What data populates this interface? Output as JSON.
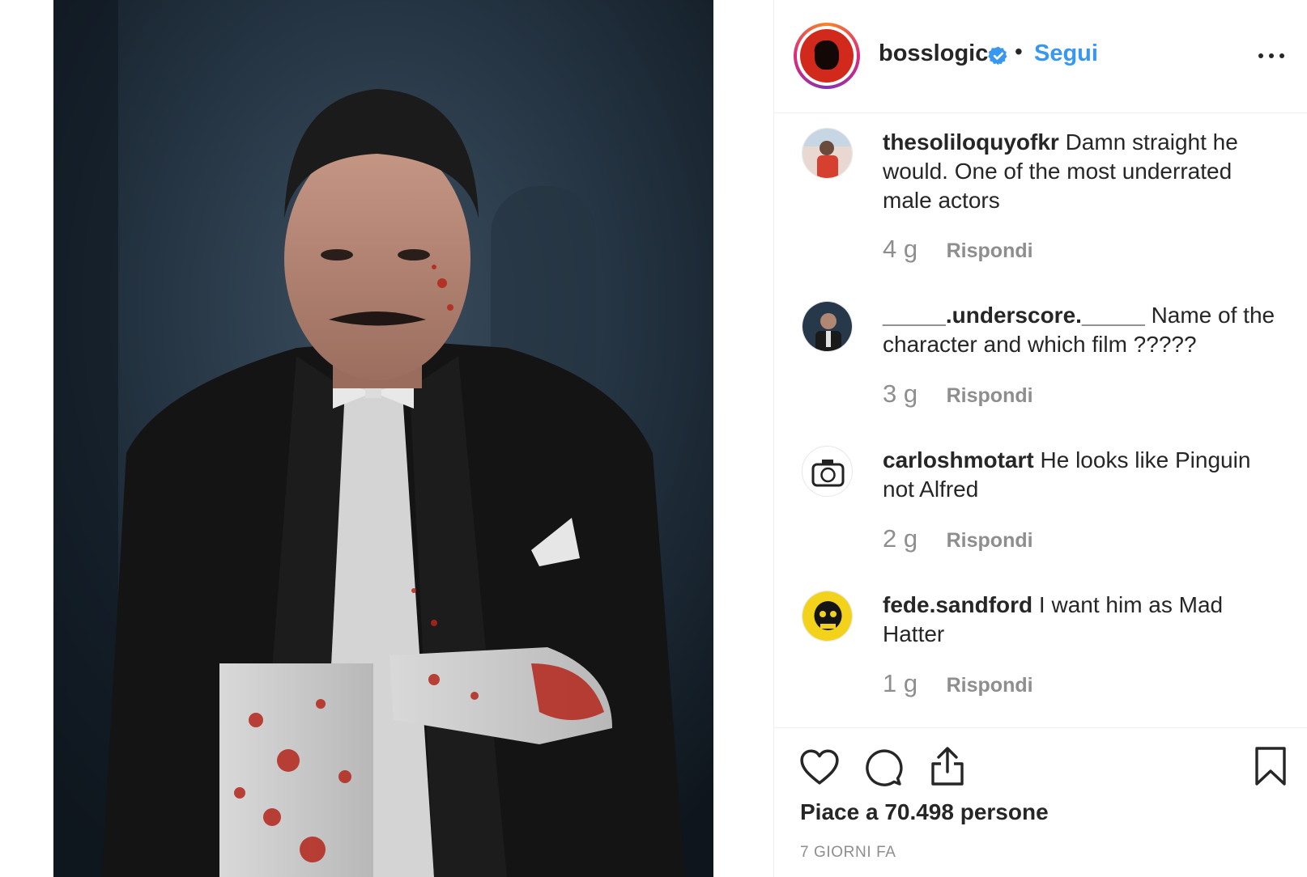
{
  "post": {
    "image_alt": "Digital artwork of a man in tuxedo with blood-spattered white gloves"
  },
  "header": {
    "username": "bosslogic",
    "separator": "•",
    "follow_label": "Segui",
    "verified_icon": "verified-badge-icon",
    "more_icon": "more-options-icon"
  },
  "comments": [
    {
      "username": "thesoliloquyofkr",
      "text": "Damn straight he would. One of the most underrated male actors",
      "time": "4 g",
      "reply_label": "Rispondi"
    },
    {
      "username": "_____.underscore._____",
      "text": "Name of the character and which film ?????",
      "time": "3 g",
      "reply_label": "Rispondi"
    },
    {
      "username": "carloshmotart",
      "text": "He looks like Pinguin not Alfred",
      "time": "2 g",
      "reply_label": "Rispondi"
    },
    {
      "username": "fede.sandford",
      "text": "I want him as Mad Hatter",
      "time": "1 g",
      "reply_label": "Rispondi"
    }
  ],
  "actions": {
    "like_icon": "heart-icon",
    "comment_icon": "comment-bubble-icon",
    "share_icon": "share-icon",
    "save_icon": "bookmark-icon",
    "likes_prefix": "Piace a",
    "likes_count": "70.498",
    "likes_suffix": "persone",
    "posted_ago": "7 GIORNI FA"
  },
  "colors": {
    "link_blue": "#3897f0",
    "text_dark": "#262626",
    "text_muted": "#8e8e8e",
    "divider": "#efefef"
  }
}
